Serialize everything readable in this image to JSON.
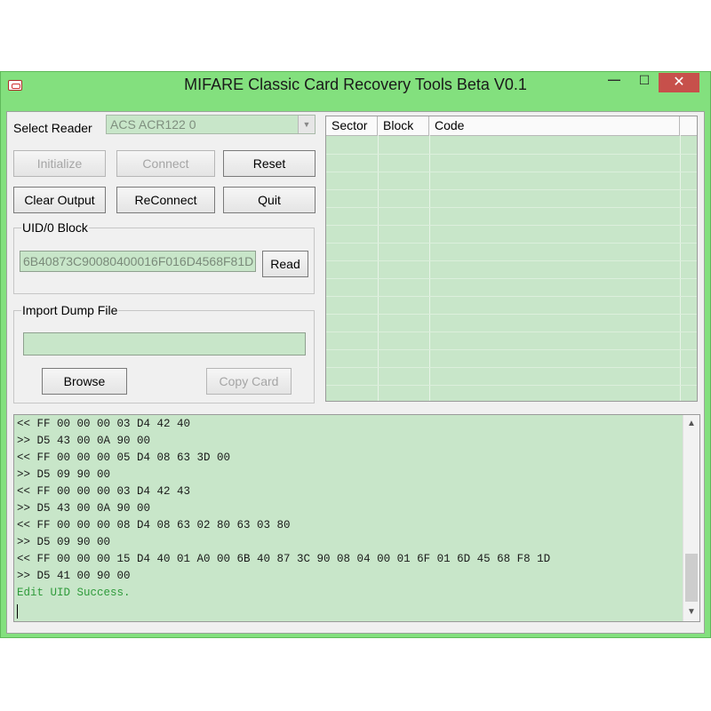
{
  "window": {
    "title": "MIFARE Classic Card Recovery Tools Beta V0.1",
    "controls": {
      "minimize": "—",
      "maximize": "☐",
      "close": "✕"
    }
  },
  "reader": {
    "label": "Select Reader",
    "selected": "ACS ACR122 0"
  },
  "buttons": {
    "initialize": "Initialize",
    "connect": "Connect",
    "reset": "Reset",
    "clear_output": "Clear Output",
    "reconnect": "ReConnect",
    "quit": "Quit",
    "read": "Read",
    "browse": "Browse",
    "copy_card": "Copy Card"
  },
  "uid_group": {
    "legend": "UID/0 Block",
    "value": "6B40873C90080400016F016D4568F81D"
  },
  "import_group": {
    "legend": "Import Dump File",
    "value": ""
  },
  "grid": {
    "columns": [
      "Sector",
      "Block",
      "Code"
    ]
  },
  "output": {
    "lines": [
      "<< FF 00 00 00 03 D4 42 40",
      ">> D5 43 00 0A 90 00",
      "<< FF 00 00 00 05 D4 08 63 3D 00",
      ">> D5 09 90 00",
      "<< FF 00 00 00 03 D4 42 43",
      ">> D5 43 00 0A 90 00",
      "<< FF 00 00 00 08 D4 08 63 02 80 63 03 80",
      ">> D5 09 90 00",
      "<< FF 00 00 00 15 D4 40 01 A0 00 6B 40 87 3C 90 08 04 00 01 6F 01 6D 45 68 F8 1D",
      ">> D5 41 00 90 00",
      "Edit UID Success."
    ]
  },
  "colors": {
    "frame": "#83e07e",
    "field_bg": "#c8e6c9",
    "close_button": "#c7504b",
    "success_text": "#2e9a3a"
  }
}
